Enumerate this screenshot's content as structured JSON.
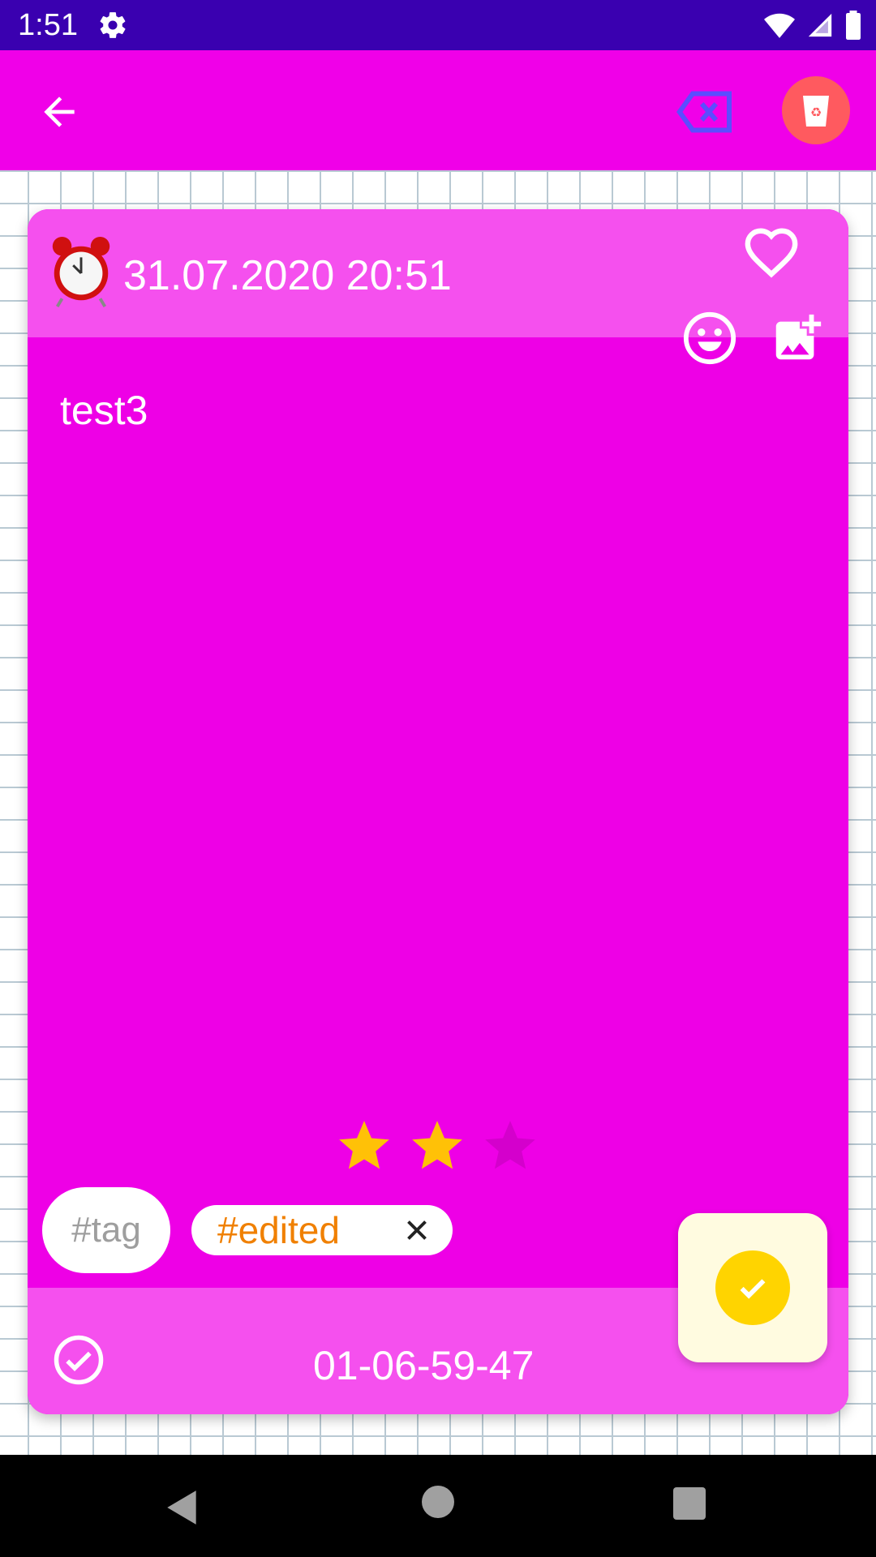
{
  "status_bar": {
    "time": "1:51"
  },
  "app_bar": {
    "back_icon": "arrow-left-icon",
    "tag_remove_icon": "tag-remove-icon",
    "delete_icon": "recycle-bin-icon"
  },
  "note": {
    "date": "31.07.2020 20:51",
    "body": "test3",
    "rating": {
      "value": 2,
      "max": 3
    },
    "add_tag_placeholder": "#tag",
    "tags": [
      {
        "label": "#edited"
      }
    ],
    "code": "01-06-59-47"
  },
  "colors": {
    "status_bar": "#3a00b0",
    "app_bar": "#f000e8",
    "card": "#ee00e6",
    "card_header": "#f550ee",
    "star_filled": "#ffc107",
    "star_empty": "#d400cc",
    "tag_text": "#f08000",
    "fab": "#ffd400"
  }
}
